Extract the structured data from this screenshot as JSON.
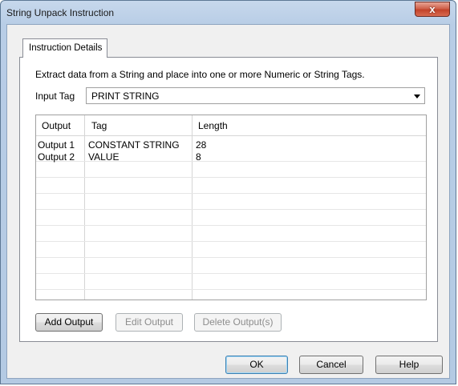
{
  "window": {
    "title": "String Unpack Instruction",
    "close_icon": "close-x-icon",
    "close_label": "x"
  },
  "tabs": [
    {
      "label": "Instruction Details",
      "active": true
    }
  ],
  "panel": {
    "description": "Extract data from a String and place into one or more Numeric or String Tags.",
    "input_tag_label": "Input Tag",
    "input_tag_value": "PRINT STRING"
  },
  "grid": {
    "columns": [
      "Output",
      "Tag",
      "Length"
    ],
    "rows": [
      {
        "output": "Output 1",
        "tag": "CONSTANT STRING",
        "length": "28"
      },
      {
        "output": "Output 2",
        "tag": "VALUE",
        "length": "8"
      }
    ]
  },
  "grid_buttons": {
    "add": "Add Output",
    "edit": "Edit Output",
    "delete": "Delete Output(s)"
  },
  "dialog_buttons": {
    "ok": "OK",
    "cancel": "Cancel",
    "help": "Help"
  }
}
